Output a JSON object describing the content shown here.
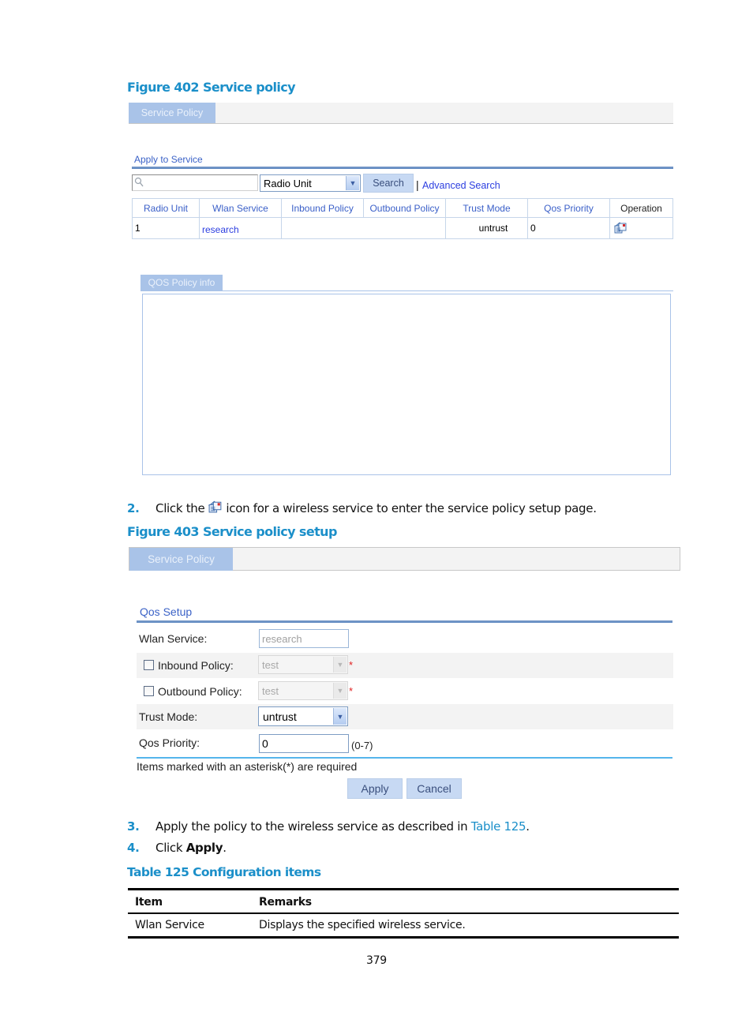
{
  "figure402": {
    "caption": "Figure 402 Service policy",
    "tab_label": "Service Policy",
    "section_title": "Apply to Service",
    "search": {
      "placeholder": "",
      "field_select_value": "Radio Unit",
      "search_button": "Search",
      "separator": "|",
      "advanced_link": "Advanced Search"
    },
    "table": {
      "columns": [
        "Radio Unit",
        "Wlan Service",
        "Inbound Policy",
        "Outbound Policy",
        "Trust Mode",
        "Qos Priority",
        "Operation"
      ],
      "rows": [
        {
          "radio_unit": "1",
          "wlan_service": "research",
          "inbound_policy": "",
          "outbound_policy": "",
          "trust_mode": "untrust",
          "qos_priority": "0",
          "operation_icon": "edit-icon"
        }
      ]
    },
    "qos_info_tab": "QOS Policy info"
  },
  "step2": {
    "number": "2.",
    "text_before": "Click the",
    "icon": "edit-icon",
    "text_after": "icon for a wireless service to enter the service policy setup page."
  },
  "figure403": {
    "caption": "Figure 403 Service policy setup",
    "tab_label": "Service Policy",
    "section_title": "Qos Setup",
    "fields": {
      "wlan_service": {
        "label": "Wlan Service:",
        "value": "research"
      },
      "inbound_policy": {
        "label": "Inbound Policy:",
        "value": "test",
        "checked": false,
        "required": "*"
      },
      "outbound_policy": {
        "label": "Outbound Policy:",
        "value": "test",
        "checked": false,
        "required": "*"
      },
      "trust_mode": {
        "label": "Trust Mode:",
        "value": "untrust"
      },
      "qos_priority": {
        "label": "Qos Priority:",
        "value": "0",
        "range_hint": "(0-7)"
      }
    },
    "required_note": "Items marked with an asterisk(*) are required",
    "apply_button": "Apply",
    "cancel_button": "Cancel"
  },
  "step3": {
    "number": "3.",
    "text": "Apply the policy to the wireless service as described in",
    "link": "Table 125",
    "end": "."
  },
  "step4": {
    "number": "4.",
    "text": "Click",
    "bold": "Apply",
    "end": "."
  },
  "table125": {
    "caption": "Table 125 Configuration items",
    "headers": [
      "Item",
      "Remarks"
    ],
    "rows": [
      {
        "item": "Wlan Service",
        "remarks": "Displays the specified wireless service."
      }
    ]
  },
  "page_number": "379",
  "colors": {
    "caption_blue": "#1b8fc9",
    "tab_blue": "#a9c3e8",
    "link_blue": "#2c3ee0",
    "required_red": "#e02020"
  }
}
